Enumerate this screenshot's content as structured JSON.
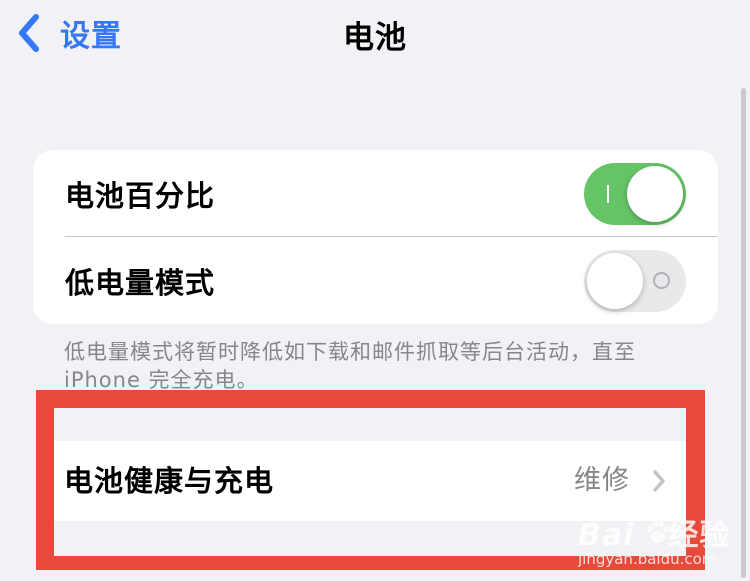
{
  "nav": {
    "back_label": "设置",
    "title": "电池"
  },
  "settings": {
    "battery_percentage": {
      "label": "电池百分比",
      "enabled": true
    },
    "low_power_mode": {
      "label": "低电量模式",
      "enabled": false
    },
    "footnote": "低电量模式将暂时降低如下载和邮件抓取等后台活动，直至 iPhone 完全充电。"
  },
  "health": {
    "label": "电池健康与充电",
    "value": "维修"
  },
  "watermark": {
    "main": "Bai",
    "main_suffix": "经验",
    "sub": "jingyan.baidu.com"
  },
  "colors": {
    "accent": "#3478f6",
    "toggle_on": "#65c466",
    "highlight_box": "#e74a3b"
  },
  "icons": [
    "chevron-left-icon",
    "chevron-right-icon",
    "toggle-switch",
    "paw-icon"
  ]
}
